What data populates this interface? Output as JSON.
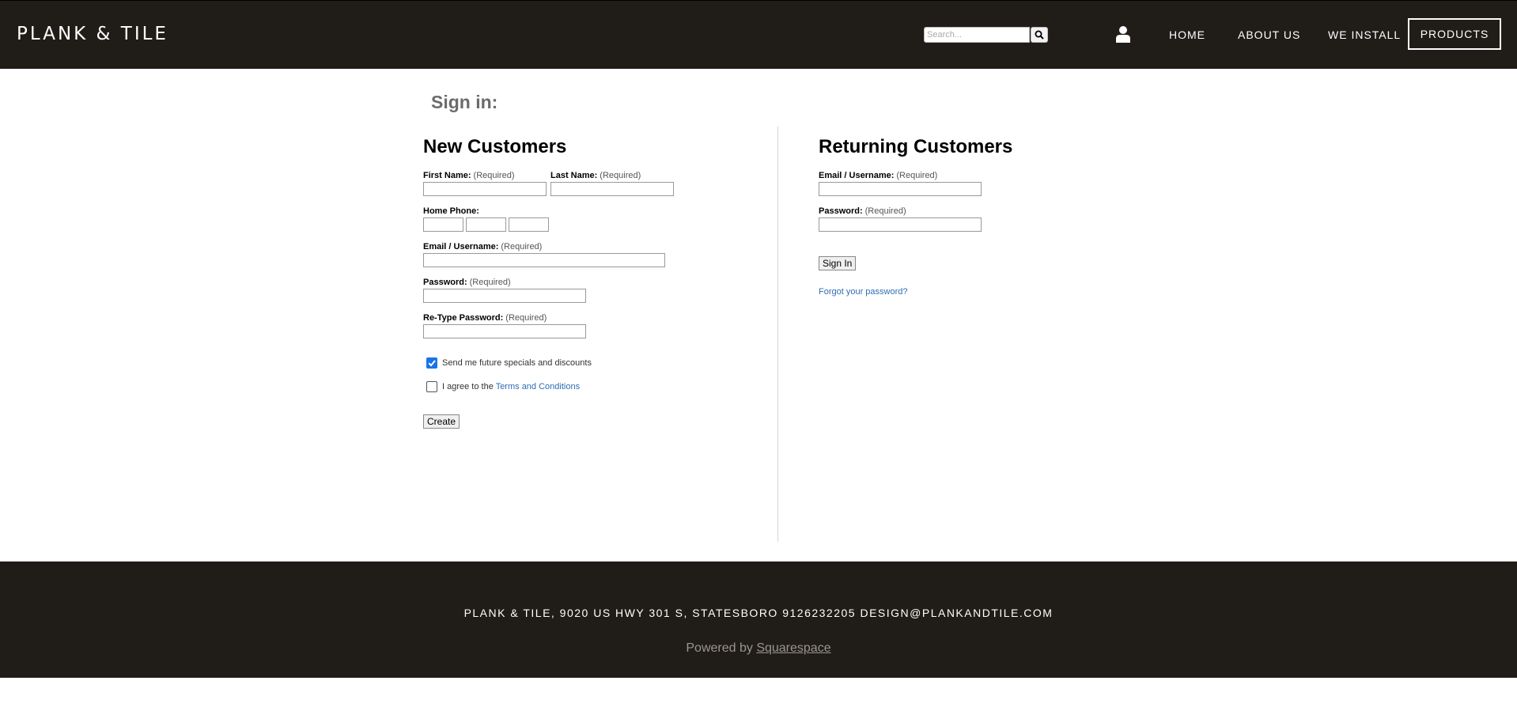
{
  "header": {
    "logo": "PLANK & TILE",
    "search": {
      "placeholder": "Search..."
    },
    "nav": {
      "home": "HOME",
      "about": "ABOUT US",
      "install": "WE INSTALL",
      "products": "PRODUCTS"
    }
  },
  "main": {
    "title": "Sign in:",
    "new_customers": {
      "heading": "New Customers",
      "first_name_label": "First Name:",
      "last_name_label": "Last Name:",
      "home_phone_label": "Home Phone:",
      "email_label": "Email / Username:",
      "password_label": "Password:",
      "retype_password_label": "Re-Type Password:",
      "required_text": "(Required)",
      "specials_label": "Send me future specials and discounts",
      "specials_checked": true,
      "agree_prefix": "I agree to the ",
      "terms_link": "Terms and Conditions",
      "agree_checked": false,
      "create_button": "Create"
    },
    "returning_customers": {
      "heading": "Returning Customers",
      "email_label": "Email / Username:",
      "password_label": "Password:",
      "required_text": "(Required)",
      "sign_in_button": "Sign In",
      "forgot_link": "Forgot your password?"
    }
  },
  "footer": {
    "address": "PLANK & TILE, 9020 US HWY 301 S, STATESBORO 9126232205 DESIGN@PLANKANDTILE.COM",
    "powered_prefix": "Powered by ",
    "powered_link": "Squarespace"
  },
  "colors": {
    "header_bg": "#201c18",
    "link": "#2f6db3",
    "checkbox_accent": "#1a73e8"
  }
}
